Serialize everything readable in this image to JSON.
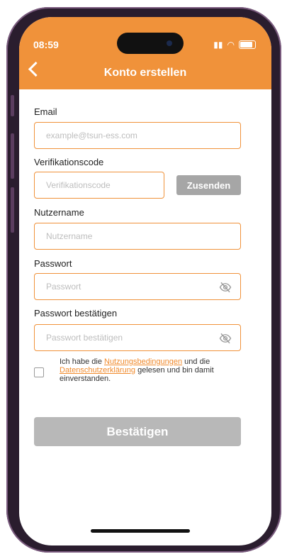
{
  "status": {
    "time": "08:59"
  },
  "header": {
    "title": "Konto erstellen"
  },
  "form": {
    "email": {
      "label": "Email",
      "placeholder": "example@tsun-ess.com",
      "value": ""
    },
    "code": {
      "label": "Verifikationscode",
      "placeholder": "Verifikationscode",
      "value": "",
      "send_label": "Zusenden"
    },
    "username": {
      "label": "Nutzername",
      "placeholder": "Nutzername",
      "value": ""
    },
    "password": {
      "label": "Passwort",
      "placeholder": "Passwort",
      "value": ""
    },
    "password_confirm": {
      "label": "Passwort bestätigen",
      "placeholder": "Passwort bestätigen",
      "value": ""
    }
  },
  "agreement": {
    "text_1": "Ich habe die",
    "link_terms": "Nutzungsbedingungen",
    "text_2": "und die",
    "link_privacy": "Datenschutzerklärung",
    "text_3": "gelesen und bin damit einverstanden.",
    "checked": false
  },
  "confirm_label": "Bestätigen",
  "colors": {
    "accent": "#f0923a",
    "button_disabled": "#b8b8b8",
    "send_button": "#a6a6a6"
  }
}
